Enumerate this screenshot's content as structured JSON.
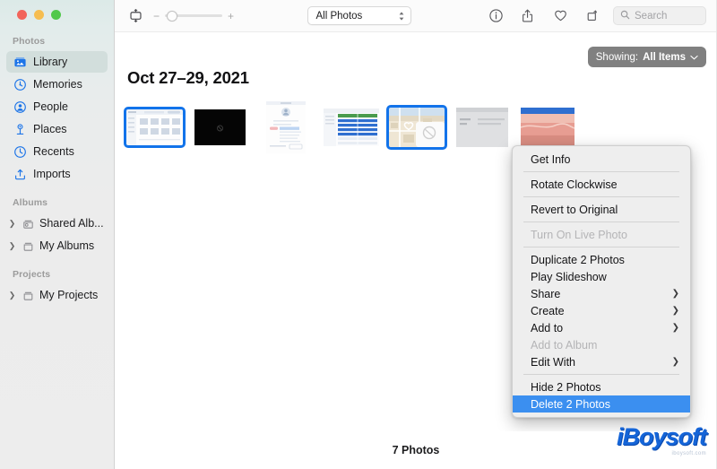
{
  "window": {
    "traffic_lights": [
      "close",
      "minimize",
      "maximize"
    ],
    "colors": {
      "red": "#f2645a",
      "yellow": "#f6bd50",
      "green": "#51c84a",
      "accent": "#3b8ff0",
      "selection": "#1273ea"
    }
  },
  "toolbar": {
    "view_toggle_icon": "sidebar-toggle-icon",
    "zoom_out_label": "−",
    "zoom_in_label": "+",
    "zoom_value": 8,
    "popup": {
      "label": "All Photos",
      "icon": "chevron-up-down-icon"
    },
    "info_icon": "info-icon",
    "share_icon": "share-icon",
    "favorite_icon": "heart-icon",
    "rotate_icon": "rotate-icon",
    "search": {
      "placeholder": "Search",
      "value": "",
      "icon": "search-icon"
    }
  },
  "sidebar": {
    "sections": [
      {
        "title": "Photos",
        "items": [
          {
            "label": "Library",
            "icon": "library-icon",
            "selected": true,
            "disclosure": false
          },
          {
            "label": "Memories",
            "icon": "memories-icon",
            "selected": false,
            "disclosure": false
          },
          {
            "label": "People",
            "icon": "people-icon",
            "selected": false,
            "disclosure": false
          },
          {
            "label": "Places",
            "icon": "places-icon",
            "selected": false,
            "disclosure": false
          },
          {
            "label": "Recents",
            "icon": "recents-icon",
            "selected": false,
            "disclosure": false
          },
          {
            "label": "Imports",
            "icon": "imports-icon",
            "selected": false,
            "disclosure": false
          }
        ]
      },
      {
        "title": "Albums",
        "items": [
          {
            "label": "Shared Alb...",
            "icon": "shared-album-icon",
            "selected": false,
            "disclosure": true
          },
          {
            "label": "My Albums",
            "icon": "album-icon",
            "selected": false,
            "disclosure": true
          }
        ]
      },
      {
        "title": "Projects",
        "items": [
          {
            "label": "My Projects",
            "icon": "project-icon",
            "selected": false,
            "disclosure": true
          }
        ]
      }
    ]
  },
  "content": {
    "showing_button": {
      "prefix": "Showing:",
      "value": "All Items",
      "icon": "chevron-down-icon"
    },
    "date_header": "Oct 27–29, 2021",
    "thumbnails": [
      {
        "id": "thumb-1",
        "kind": "screenshot-toolbar",
        "selected": true
      },
      {
        "id": "thumb-2",
        "kind": "black-photo",
        "selected": false
      },
      {
        "id": "thumb-3",
        "kind": "screenshot-dialog",
        "selected": false
      },
      {
        "id": "thumb-4",
        "kind": "screenshot-table",
        "selected": false
      },
      {
        "id": "thumb-5",
        "kind": "screenshot-map",
        "selected": true
      },
      {
        "id": "thumb-6",
        "kind": "screenshot-grey",
        "selected": false
      },
      {
        "id": "thumb-7",
        "kind": "photo-pink",
        "selected": false
      }
    ],
    "status": "7 Photos"
  },
  "context_menu": {
    "items": [
      {
        "label": "Get Info",
        "disabled": false,
        "submenu": false,
        "highlighted": false,
        "separator_after": true
      },
      {
        "label": "Rotate Clockwise",
        "disabled": false,
        "submenu": false,
        "highlighted": false,
        "separator_after": true
      },
      {
        "label": "Revert to Original",
        "disabled": false,
        "submenu": false,
        "highlighted": false,
        "separator_after": true
      },
      {
        "label": "Turn On Live Photo",
        "disabled": true,
        "submenu": false,
        "highlighted": false,
        "separator_after": true
      },
      {
        "label": "Duplicate 2 Photos",
        "disabled": false,
        "submenu": false,
        "highlighted": false,
        "separator_after": false
      },
      {
        "label": "Play Slideshow",
        "disabled": false,
        "submenu": false,
        "highlighted": false,
        "separator_after": false
      },
      {
        "label": "Share",
        "disabled": false,
        "submenu": true,
        "highlighted": false,
        "separator_after": false
      },
      {
        "label": "Create",
        "disabled": false,
        "submenu": true,
        "highlighted": false,
        "separator_after": false
      },
      {
        "label": "Add to",
        "disabled": false,
        "submenu": true,
        "highlighted": false,
        "separator_after": false
      },
      {
        "label": "Add to Album",
        "disabled": true,
        "submenu": false,
        "highlighted": false,
        "separator_after": false
      },
      {
        "label": "Edit With",
        "disabled": false,
        "submenu": true,
        "highlighted": false,
        "separator_after": true
      },
      {
        "label": "Hide 2 Photos",
        "disabled": false,
        "submenu": false,
        "highlighted": false,
        "separator_after": false
      },
      {
        "label": "Delete 2 Photos",
        "disabled": false,
        "submenu": false,
        "highlighted": true,
        "separator_after": false
      }
    ]
  },
  "watermark": {
    "logo": "iBoysoft",
    "sub": "iboysoft.com"
  }
}
